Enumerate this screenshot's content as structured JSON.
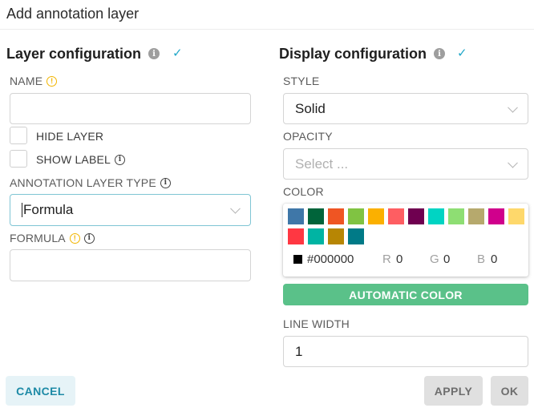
{
  "modal": {
    "title": "Add annotation layer"
  },
  "layer_config": {
    "title": "Layer configuration",
    "info_glyph": "i",
    "check_glyph": "✓",
    "name": {
      "label": "NAME",
      "value": "",
      "warn_glyph": "!"
    },
    "hide_layer": {
      "label": "HIDE LAYER",
      "checked": false
    },
    "show_label": {
      "label": "SHOW LABEL",
      "checked": false
    },
    "annotation_type": {
      "label": "ANNOTATION LAYER TYPE",
      "value": "Formula"
    },
    "formula": {
      "label": "FORMULA",
      "value": "",
      "warn_glyph": "!"
    }
  },
  "display_config": {
    "title": "Display configuration",
    "info_glyph": "i",
    "check_glyph": "✓",
    "style": {
      "label": "STYLE",
      "value": "Solid"
    },
    "opacity": {
      "label": "OPACITY",
      "placeholder": "Select ..."
    },
    "color": {
      "label": "COLOR",
      "swatches": [
        "#3f77a8",
        "#00643a",
        "#ef5523",
        "#80c342",
        "#fbb000",
        "#fe5e62",
        "#6f0050",
        "#00d4c3",
        "#8ede73",
        "#b6a96d",
        "#d0008c",
        "#fed86b",
        "#ff3742",
        "#00b4a3",
        "#b78604",
        "#007a87"
      ],
      "hex": "#000000",
      "r_label": "R",
      "r_value": "0",
      "g_label": "G",
      "g_value": "0",
      "b_label": "B",
      "b_value": "0"
    },
    "automatic_color": "AUTOMATIC COLOR",
    "line_width": {
      "label": "LINE WIDTH",
      "value": "1"
    }
  },
  "footer": {
    "cancel": "CANCEL",
    "apply": "APPLY",
    "ok": "OK"
  },
  "colors": {
    "accent": "#20a7c9",
    "auto_color_bg": "#5ac189",
    "cancel_bg": "#e6f3f7"
  }
}
